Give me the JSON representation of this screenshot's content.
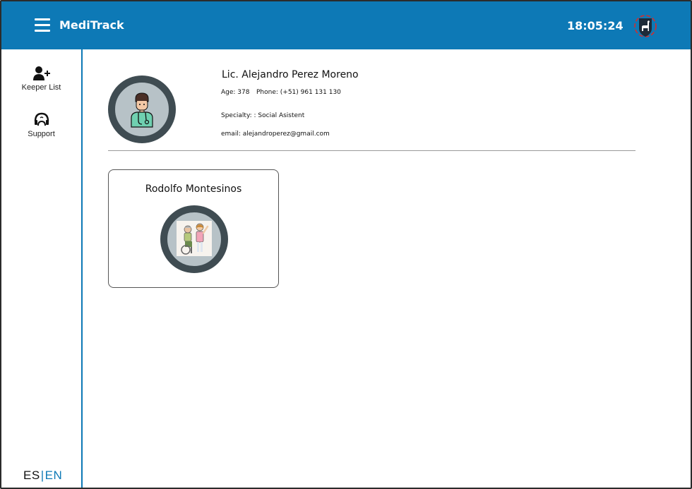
{
  "app": {
    "title": "MediTrack",
    "clock": "18:05:24",
    "accent_color": "#0d79b6"
  },
  "header": {
    "menu_icon": "hamburger-menu-icon",
    "logo_icon": "llama-shield-logo"
  },
  "sidebar": {
    "items": [
      {
        "label": "Keeper List",
        "icon": "add-user-icon"
      },
      {
        "label": "Support",
        "icon": "headset-icon"
      }
    ],
    "language": {
      "es": "ES",
      "separator": "|",
      "en": "EN",
      "active": "EN"
    }
  },
  "profile": {
    "name": "Lic. Alejandro Perez Moreno",
    "age": "Age: 378",
    "phone": "Phone: (+51) 961 131 130",
    "specialty": "Specialty: : Social Asistent",
    "email": "email: alejandroperez@gmail.com",
    "avatar_icon": "doctor-avatar-icon"
  },
  "patients": [
    {
      "name": "Rodolfo Montesinos",
      "avatar_icon": "patient-wheelchair-avatar"
    }
  ]
}
